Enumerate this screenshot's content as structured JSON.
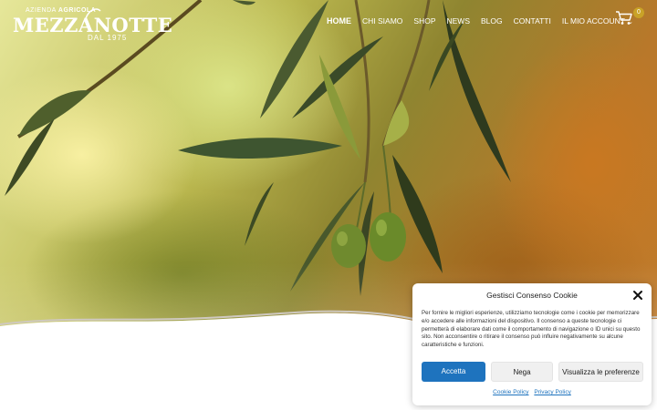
{
  "brand": {
    "line_top_light": "AZIENDA",
    "line_top_bold": "AGRICOLA",
    "name": "MEZZANOTTE",
    "since": "DAL 1975"
  },
  "nav": {
    "items": [
      {
        "label": "HOME",
        "active": true
      },
      {
        "label": "CHI SIAMO",
        "active": false
      },
      {
        "label": "SHOP",
        "active": false
      },
      {
        "label": "NEWS",
        "active": false
      },
      {
        "label": "BLOG",
        "active": false
      },
      {
        "label": "CONTATTI",
        "active": false
      },
      {
        "label": "IL MIO ACCOUNT",
        "active": false
      }
    ]
  },
  "cart": {
    "count": "0",
    "icon": "cart-icon"
  },
  "cookie": {
    "title": "Gestisci Consenso Cookie",
    "body": "Per fornire le migliori esperienze, utilizziamo tecnologie come i cookie per memorizzare e/o accedere alle informazioni del dispositivo. Il consenso a queste tecnologie ci permetterà di elaborare dati come il comportamento di navigazione o ID unici su questo sito. Non acconsentire o ritirare il consenso può influire negativamente su alcune caratteristiche e funzioni.",
    "accept_label": "Accetta",
    "deny_label": "Nega",
    "prefs_label": "Visualizza le preferenze",
    "cookie_policy_label": "Cookie Policy",
    "privacy_policy_label": "Privacy Policy"
  },
  "colors": {
    "accent": "#1e73be",
    "badge": "#c9a227"
  }
}
